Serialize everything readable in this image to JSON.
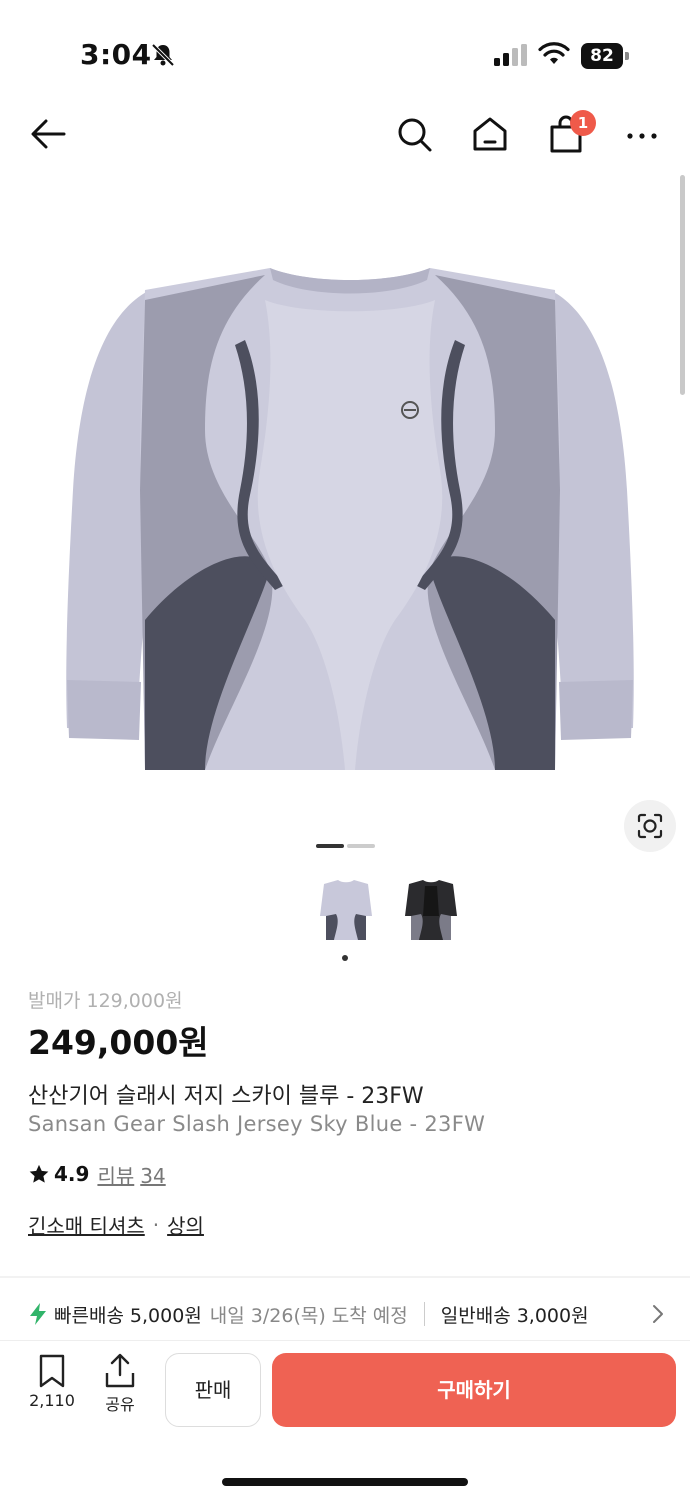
{
  "status": {
    "time": "3:04",
    "battery": "82"
  },
  "nav": {
    "cart_badge": "1"
  },
  "product": {
    "release_label": "발매가",
    "release_price": "129,000원",
    "price": "249,000원",
    "name_ko": "산산기어 슬래시 저지 스카이 블루 - 23FW",
    "name_en": "Sansan Gear Slash Jersey Sky Blue - 23FW",
    "rating": "4.9",
    "review_label": "리뷰",
    "review_count": "34",
    "category_1": "긴소매 티셔츠",
    "category_2": "상의"
  },
  "delivery": {
    "fast_label": "빠른배송",
    "fast_price": "5,000원",
    "fast_note": "내일 3/26(목) 도착 예정",
    "normal_label": "일반배송",
    "normal_price": "3,000원"
  },
  "bottom": {
    "save_count": "2,110",
    "share_label": "공유",
    "sell_label": "판매",
    "buy_label": "구매하기"
  },
  "colors": {
    "accent": "#ef6253",
    "badge": "#ef5a4a",
    "bolt": "#31b46a"
  },
  "icons": [
    "back-arrow-icon",
    "search-icon",
    "home-icon",
    "cart-icon",
    "more-icon",
    "lens-icon",
    "star-icon",
    "bolt-icon",
    "chevron-right-icon",
    "bookmark-icon",
    "share-icon"
  ]
}
